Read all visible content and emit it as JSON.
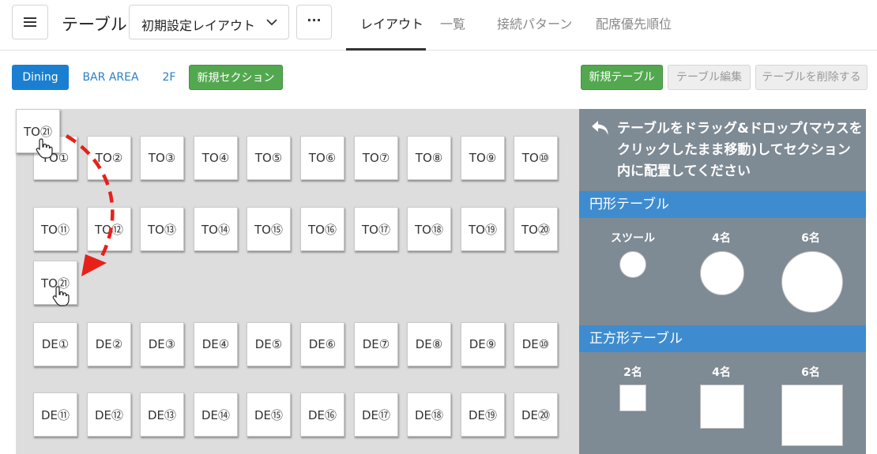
{
  "header": {
    "title": "テーブル",
    "layout_select": "初期設定レイアウト",
    "more_label": "···",
    "tabs": [
      {
        "label": "レイアウト",
        "active": true
      },
      {
        "label": "一覧",
        "active": false
      },
      {
        "label": "接続パターン",
        "active": false
      },
      {
        "label": "配席優先順位",
        "active": false
      }
    ]
  },
  "sections": {
    "items": [
      "Dining",
      "BAR AREA",
      "2F"
    ],
    "active": "Dining",
    "new_section": "新規セクション"
  },
  "actions": {
    "new_table": "新規テーブル",
    "edit_table": "テーブル編集",
    "delete_table": "テーブルを削除する"
  },
  "tables": {
    "to_row1": [
      "TO①",
      "TO②",
      "TO③",
      "TO④",
      "TO⑤",
      "TO⑥",
      "TO⑦",
      "TO⑧",
      "TO⑨",
      "TO⑩"
    ],
    "to_row2": [
      "TO⑪",
      "TO⑫",
      "TO⑬",
      "TO⑭",
      "TO⑮",
      "TO⑯",
      "TO⑰",
      "TO⑱",
      "TO⑲",
      "TO⑳"
    ],
    "placed": "TO㉑",
    "de_row1": [
      "DE①",
      "DE②",
      "DE③",
      "DE④",
      "DE⑤",
      "DE⑥",
      "DE⑦",
      "DE⑧",
      "DE⑨",
      "DE⑩"
    ],
    "de_row2": [
      "DE⑪",
      "DE⑫",
      "DE⑬",
      "DE⑭",
      "DE⑮",
      "DE⑯",
      "DE⑰",
      "DE⑱",
      "DE⑲",
      "DE⑳"
    ],
    "dragging": "TO㉑"
  },
  "palette": {
    "hint": "テーブルをドラッグ&ドロップ(マウスをクリックしたまま移動)してセクション内に配置してください",
    "round_heading": "円形テーブル",
    "round_items": [
      "スツール",
      "4名",
      "6名"
    ],
    "square_heading": "正方形テーブル",
    "square_items": [
      "2名",
      "4名",
      "6名"
    ]
  },
  "colors": {
    "accent_blue": "#1a7fd1",
    "green": "#53a84f",
    "palette_bg": "#7e8a94",
    "palette_header": "#3e8ccf",
    "drag_arrow": "#e8201a"
  },
  "icons": {
    "menu": "hamburger-icon",
    "select": "chevron-down-icon",
    "undo": "undo-arrow-icon",
    "cursor": "hand-pointer-icon"
  }
}
